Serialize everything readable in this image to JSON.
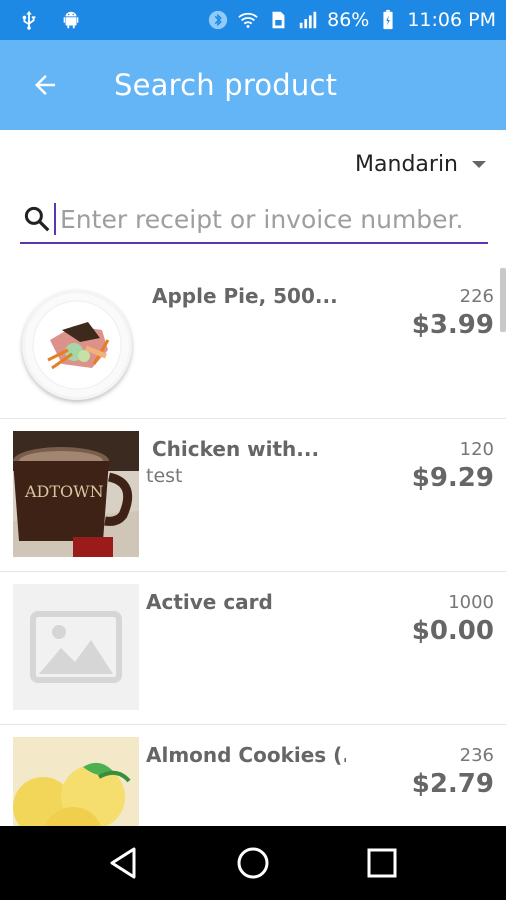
{
  "status_bar": {
    "battery": "86%",
    "time": "11:06 PM",
    "icons": [
      "usb-icon",
      "android-icon",
      "bluetooth-icon",
      "wifi-icon",
      "sim-icon",
      "signal-icon",
      "battery-icon"
    ]
  },
  "app_bar": {
    "title": "Search product",
    "back_icon": "arrow-left-icon"
  },
  "language": {
    "selected": "Mandarin"
  },
  "search": {
    "value": "",
    "placeholder": "Enter receipt or invoice number."
  },
  "products": [
    {
      "name": "Apple Pie, 500...",
      "subtitle": "",
      "quantity": "226",
      "price": "$3.99"
    },
    {
      "name": "Chicken with...",
      "subtitle": "test",
      "quantity": "120",
      "price": "$9.29"
    },
    {
      "name": "Active card",
      "subtitle": "",
      "quantity": "1000",
      "price": "$0.00"
    },
    {
      "name": "Almond Cookies (...",
      "subtitle": "",
      "quantity": "236",
      "price": "$2.79"
    }
  ],
  "colors": {
    "status_bar": "#1e88e5",
    "app_bar": "#64b5f6",
    "search_underline": "#5e35b1"
  }
}
